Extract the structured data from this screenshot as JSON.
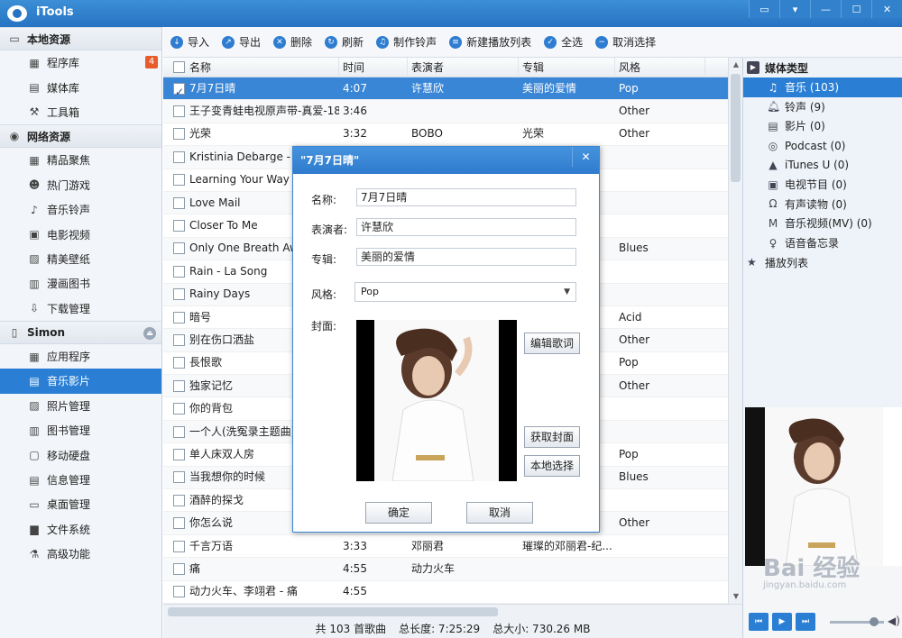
{
  "app": {
    "title": "iTools"
  },
  "sidebar": {
    "sections": [
      {
        "title": "本地资源",
        "items": [
          {
            "label": "程序库",
            "badge": "4"
          },
          {
            "label": "媒体库"
          },
          {
            "label": "工具箱"
          }
        ]
      },
      {
        "title": "网络资源",
        "items": [
          {
            "label": "精品聚焦"
          },
          {
            "label": "热门游戏"
          },
          {
            "label": "音乐铃声"
          },
          {
            "label": "电影视频"
          },
          {
            "label": "精美壁纸"
          },
          {
            "label": "漫画图书"
          },
          {
            "label": "下载管理"
          }
        ]
      },
      {
        "title": "Simon",
        "items": [
          {
            "label": "应用程序"
          },
          {
            "label": "音乐影片"
          },
          {
            "label": "照片管理"
          },
          {
            "label": "图书管理"
          },
          {
            "label": "移动硬盘"
          },
          {
            "label": "信息管理"
          },
          {
            "label": "桌面管理"
          },
          {
            "label": "文件系统"
          },
          {
            "label": "高级功能"
          }
        ]
      }
    ]
  },
  "toolbar": {
    "import": "导入",
    "export": "导出",
    "delete": "删除",
    "refresh": "刷新",
    "make_ringtone": "制作铃声",
    "new_playlist": "新建播放列表",
    "select_all": "全选",
    "deselect": "取消选择"
  },
  "table": {
    "headers": {
      "name": "名称",
      "time": "时间",
      "artist": "表演者",
      "album": "专辑",
      "genre": "风格"
    },
    "rows": [
      {
        "name": "7月7日晴",
        "time": "4:07",
        "artist": "许慧欣",
        "album": "美丽的爱情",
        "genre": "Pop"
      },
      {
        "name": "王子变青蛙电视原声带-真爱-183cl...",
        "time": "3:46",
        "artist": "",
        "album": "",
        "genre": "Other"
      },
      {
        "name": "光荣",
        "time": "3:32",
        "artist": "BOBO",
        "album": "光荣",
        "genre": "Other"
      },
      {
        "name": "Kristinia Debarge - T",
        "time": "",
        "artist": "",
        "album": "",
        "genre": ""
      },
      {
        "name": "Learning Your Way",
        "time": "",
        "artist": "",
        "album": "g",
        "genre": ""
      },
      {
        "name": "Love Mail",
        "time": "",
        "artist": "",
        "album": "",
        "genre": ""
      },
      {
        "name": "Closer To Me",
        "time": "",
        "artist": "",
        "album": "e",
        "genre": ""
      },
      {
        "name": "Only One Breath Awa",
        "time": "",
        "artist": "",
        "album": "",
        "genre": "Blues"
      },
      {
        "name": "Rain - La Song",
        "time": "",
        "artist": "",
        "album": "",
        "genre": ""
      },
      {
        "name": "Rainy Days",
        "time": "",
        "artist": "",
        "album": "ALL",
        "genre": ""
      },
      {
        "name": "暗号",
        "time": "",
        "artist": "",
        "album": "",
        "genre": "Acid"
      },
      {
        "name": "别在伤口洒盐",
        "time": "",
        "artist": "",
        "album": "",
        "genre": "Other"
      },
      {
        "name": "長恨歌",
        "time": "",
        "artist": "",
        "album": "",
        "genre": "Pop"
      },
      {
        "name": "独家记忆",
        "time": "",
        "artist": "",
        "album": "",
        "genre": "Other"
      },
      {
        "name": "你的背包",
        "time": "",
        "artist": "",
        "album": "",
        "genre": ""
      },
      {
        "name": "一个人(洗冤录主题曲)",
        "time": "",
        "artist": "",
        "album": "选",
        "genre": ""
      },
      {
        "name": "单人床双人房",
        "time": "",
        "artist": "",
        "album": "",
        "genre": "Pop"
      },
      {
        "name": "当我想你的时候",
        "time": "",
        "artist": "",
        "album": "的飘扬",
        "genre": "Blues"
      },
      {
        "name": "酒醉的探戈",
        "time": "",
        "artist": "",
        "album": "天蝶系...",
        "genre": ""
      },
      {
        "name": "你怎么说",
        "time": "",
        "artist": "",
        "album": "",
        "genre": "Other"
      },
      {
        "name": "千言万语",
        "time": "3:33",
        "artist": "邓丽君",
        "album": "璀璨的邓丽君-纪...",
        "genre": ""
      },
      {
        "name": "痛",
        "time": "4:55",
        "artist": "动力火车",
        "album": "",
        "genre": ""
      },
      {
        "name": "动力火车、李翊君 - 痛",
        "time": "4:55",
        "artist": "",
        "album": "",
        "genre": ""
      }
    ]
  },
  "status": {
    "count": "共 103 首歌曲",
    "length": "总长度: 7:25:29",
    "size": "总大小: 730.26 MB"
  },
  "right_panel": {
    "header": "媒体类型",
    "items": [
      {
        "label": "音乐 (103)",
        "icon": "music-note-icon"
      },
      {
        "label": "铃声 (9)",
        "icon": "bell-icon"
      },
      {
        "label": "影片 (0)",
        "icon": "film-icon"
      },
      {
        "label": "Podcast (0)",
        "icon": "podcast-icon"
      },
      {
        "label": "iTunes U (0)",
        "icon": "graduation-cap-icon"
      },
      {
        "label": "电视节目 (0)",
        "icon": "tv-icon"
      },
      {
        "label": "有声读物 (0)",
        "icon": "headphones-icon"
      },
      {
        "label": "音乐视频(MV) (0)",
        "icon": "music-video-icon"
      },
      {
        "label": "语音备忘录",
        "icon": "microphone-icon"
      }
    ],
    "playlist": "播放列表"
  },
  "dialog": {
    "title": "\"7月7日晴\"",
    "name_label": "名称:",
    "name_value": "7月7日晴",
    "artist_label": "表演者:",
    "artist_value": "许慧欣",
    "album_label": "专辑:",
    "album_value": "美丽的爱情",
    "genre_label": "风格:",
    "genre_value": "Pop",
    "cover_label": "封面:",
    "edit_lyrics": "编辑歌词",
    "fetch_cover": "获取封面",
    "local_select": "本地选择",
    "ok": "确定",
    "cancel": "取消"
  },
  "watermark": {
    "brand": "Bai 经验",
    "url": "jingyan.baidu.com"
  }
}
